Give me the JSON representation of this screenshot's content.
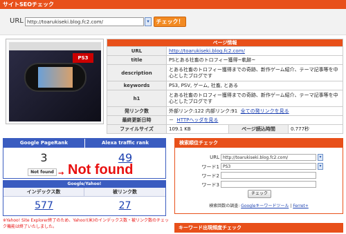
{
  "header": {
    "title": "サイトSEOチェック"
  },
  "search": {
    "label": "URL",
    "value": "http://toarukiseki.blog.fc2.com/",
    "button": "チェック！"
  },
  "page_info": {
    "heading": "ページ情報",
    "url_label": "URL",
    "url": "http://toarukiseki.blog.fc2.com/",
    "title_label": "title",
    "title": "PSとある社畜のトロフィー獲得~軌跡~",
    "description_label": "description",
    "description": "とある社畜のトロフィー獲得までの奇跡、新作ゲーム紹介、テーマ記事等を中心としたブログです",
    "keywords_label": "keywords",
    "keywords": "PS3, PSV, ゲーム, 社畜, とある",
    "h1_label": "h1",
    "h1": "とある社畜のトロフィー獲得までの奇跡、新作ゲーム紹介、テーマ記事等を中心としたブログです",
    "links_label": "発リンク数",
    "links_value": "外部リンク:122  内部リンク:91",
    "links_link": "全ての発リンクを見る",
    "updated_label": "最終更新日時",
    "updated_value": "－",
    "updated_link": "HTTPヘッダを見る",
    "filesize_label": "ファイルサイズ",
    "filesize": "109.1 KB",
    "loadtime_label": "ページ読込時間",
    "loadtime": "0.777秒"
  },
  "thumbnail": {
    "badge": "PS3"
  },
  "pagerank": {
    "google_label": "Google PageRank",
    "google_value": "3",
    "alexa_label": "Alexa traffic rank",
    "alexa_value": "49",
    "notfound_small": "Not found",
    "arrow": "→",
    "notfound_big": "Not found"
  },
  "google_yahoo": {
    "heading": "Google/Yahoo!",
    "index_label": "インデックス数",
    "index_value": "577",
    "backlink_label": "被リンク数",
    "backlink_value": "27",
    "note": "※Yahoo! Site Explorer終了のため、Yahoo!(米)のインデックス数・被リンク数のチェック機能は終了いたしました。"
  },
  "ranking": {
    "heading": "検索順位チェック",
    "url_label": "URL",
    "url_value": "http://toarukiseki.blog.fc2.com/",
    "word1_label": "ワード1",
    "word1_value": "PS3",
    "word2_label": "ワード2",
    "word2_value": "",
    "word3_label": "ワード3",
    "word3_value": "",
    "button": "チェック",
    "footer_prefix": "検索回数の調査:",
    "footer_link1": "Googleキーワードツール",
    "footer_sep": " | ",
    "footer_link2": "Ferret+"
  },
  "keyword_check": {
    "heading": "キーワード出現頻度チェック"
  },
  "colors": {
    "accent": "#e8501a",
    "blue": "#3a5cc0",
    "alert": "#e81010"
  }
}
